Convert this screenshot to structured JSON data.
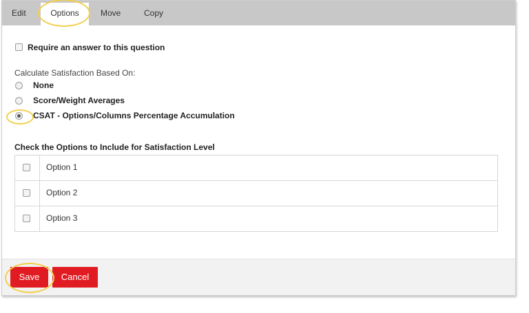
{
  "tabs": [
    {
      "label": "Edit"
    },
    {
      "label": "Options",
      "active": true
    },
    {
      "label": "Move"
    },
    {
      "label": "Copy"
    }
  ],
  "require_answer": {
    "label": "Require an answer to this question",
    "checked": false
  },
  "satisfaction": {
    "label": "Calculate Satisfaction Based On:",
    "options": [
      {
        "label": "None",
        "checked": false
      },
      {
        "label": "Score/Weight Averages",
        "checked": false
      },
      {
        "label": "CSAT - Options/Columns Percentage Accumulation",
        "checked": true
      }
    ]
  },
  "options_section": {
    "title": "Check the Options to Include for Satisfaction Level",
    "rows": [
      {
        "label": "Option 1",
        "checked": false
      },
      {
        "label": "Option 2",
        "checked": false
      },
      {
        "label": "Option 3",
        "checked": false
      }
    ]
  },
  "footer": {
    "save_label": "Save",
    "cancel_label": "Cancel"
  },
  "colors": {
    "accent": "#e11b22",
    "highlight": "#f2cf4a",
    "tabbar": "#c8c8c8"
  }
}
